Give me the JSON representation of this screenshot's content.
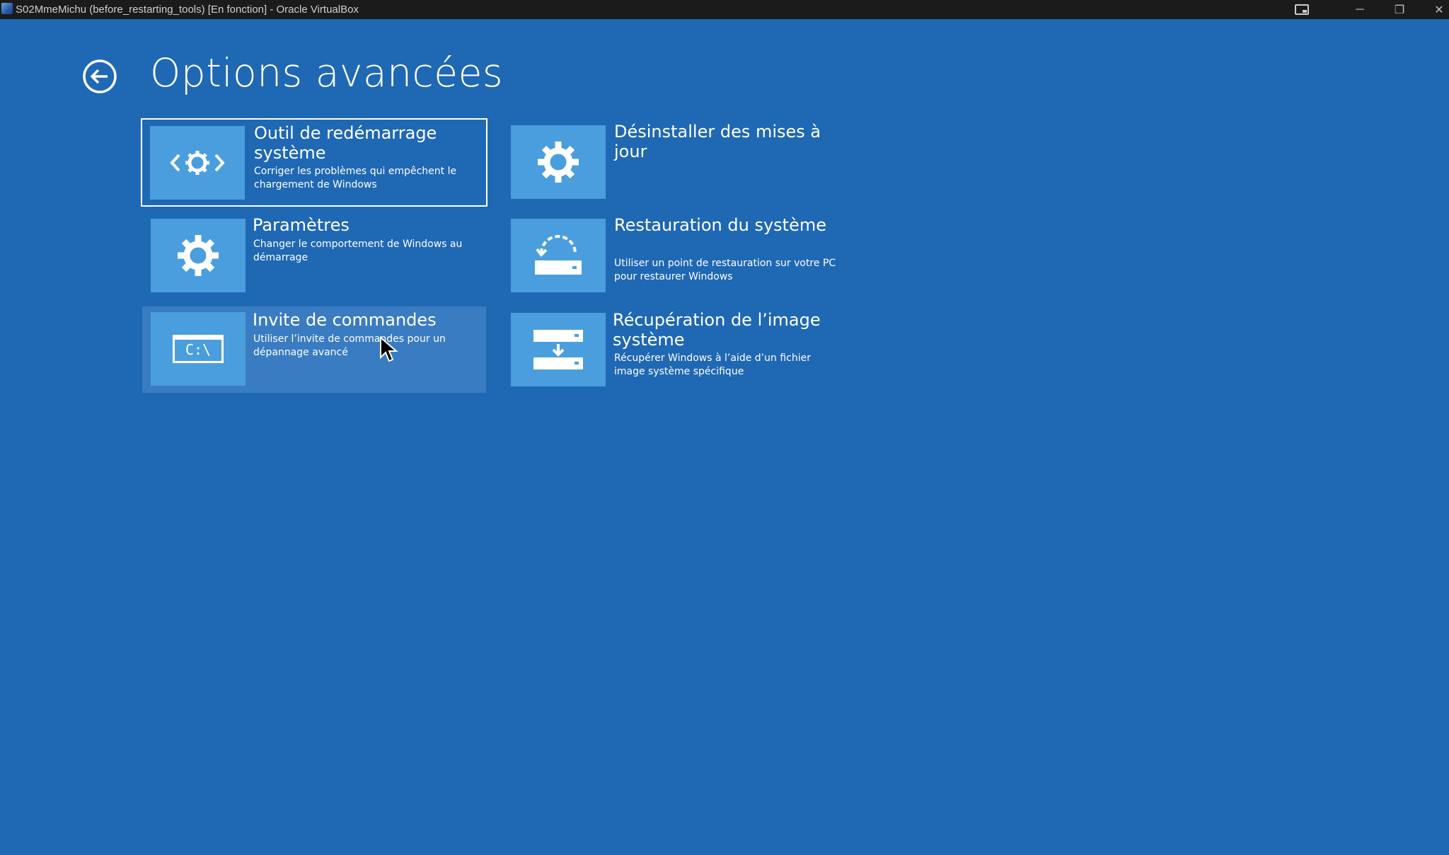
{
  "window": {
    "title": "S02MmeMichu (before_restarting_tools) [En fonction] - Oracle VirtualBox",
    "controls": {
      "cast": "cast-icon",
      "minimize": "─",
      "restore": "❐",
      "close": "✕"
    }
  },
  "page": {
    "title": "Options avancées",
    "back_icon": "back-arrow-icon"
  },
  "options": [
    {
      "id": "startup-repair",
      "title": "Outil de redémarrage système",
      "description": "Corriger les problèmes qui empêchent le chargement de Windows",
      "icon": "startup-repair-icon",
      "state": "focused"
    },
    {
      "id": "uninstall-updates",
      "title": "Désinstaller des mises à jour",
      "description": "",
      "icon": "gear-icon",
      "state": "normal"
    },
    {
      "id": "startup-settings",
      "title": "Paramètres",
      "description": "Changer le comportement de Windows au démarrage",
      "icon": "gear-icon",
      "state": "normal"
    },
    {
      "id": "system-restore",
      "title": "Restauration du système",
      "description": "Utiliser un point de restauration sur votre PC pour restaurer Windows",
      "icon": "system-restore-icon",
      "state": "normal"
    },
    {
      "id": "command-prompt",
      "title": "Invite de commandes",
      "description": "Utiliser l’invite de commandes pour un dépannage avancé",
      "icon": "command-prompt-icon",
      "icon_text": "C:\\",
      "state": "hovered"
    },
    {
      "id": "system-image-recovery",
      "title": "Récupération de l’image système",
      "description": "Récupérer Windows à l’aide d’un fichier image système spécifique",
      "icon": "system-image-icon",
      "state": "normal"
    }
  ],
  "colors": {
    "background": "#1f68b4",
    "tile_icon": "#4a9edd",
    "hover": "#3a7cc1",
    "titlebar": "#1b1b1b",
    "text": "#ffffff"
  }
}
